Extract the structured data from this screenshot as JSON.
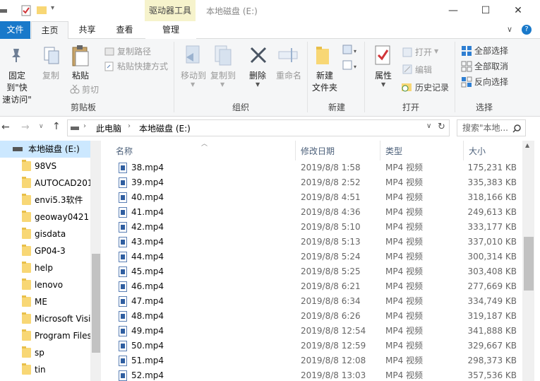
{
  "title_bar": {
    "context_tab": "驱动器工具",
    "window_title": "本地磁盘 (E:)",
    "minimize": "—",
    "maximize": "☐",
    "close": "✕"
  },
  "tabs": {
    "file": "文件",
    "home": "主页",
    "share": "共享",
    "view": "查看",
    "manage": "管理"
  },
  "ribbon": {
    "clipboard": {
      "label": "剪贴板",
      "pin_line1": "固定到\"快",
      "pin_line2": "速访问\"",
      "copy": "复制",
      "paste": "粘贴",
      "copy_path": "复制路径",
      "paste_shortcut": "粘贴快捷方式",
      "cut": "剪切"
    },
    "organize": {
      "label": "组织",
      "move_to": "移动到",
      "copy_to": "复制到",
      "delete": "删除",
      "rename": "重命名"
    },
    "new": {
      "label": "新建",
      "new_folder_line1": "新建",
      "new_folder_line2": "文件夹"
    },
    "open": {
      "label": "打开",
      "properties": "属性",
      "open": "打开",
      "edit": "编辑",
      "history": "历史记录"
    },
    "select": {
      "label": "选择",
      "select_all": "全部选择",
      "select_none": "全部取消",
      "invert": "反向选择"
    }
  },
  "address": {
    "crumb1": "此电脑",
    "crumb2": "本地磁盘 (E:)",
    "search_placeholder": "搜索\"本地..."
  },
  "nav": {
    "drive": "本地磁盘 (E:)",
    "folders": [
      "98VS",
      "AUTOCAD201",
      "envi5.3软件",
      "geoway0421",
      "gisdata",
      "GP04-3",
      "help",
      "lenovo",
      "ME",
      "Microsoft Visi",
      "Program Files",
      "sp",
      "tin"
    ]
  },
  "columns": {
    "name": "名称",
    "date": "修改日期",
    "type": "类型",
    "size": "大小"
  },
  "files": [
    {
      "name": "38.mp4",
      "date": "2019/8/8 1:58",
      "type": "MP4 视频",
      "size": "175,231 KB"
    },
    {
      "name": "39.mp4",
      "date": "2019/8/8 2:52",
      "type": "MP4 视频",
      "size": "335,383 KB"
    },
    {
      "name": "40.mp4",
      "date": "2019/8/8 4:51",
      "type": "MP4 视频",
      "size": "318,166 KB"
    },
    {
      "name": "41.mp4",
      "date": "2019/8/8 4:36",
      "type": "MP4 视频",
      "size": "249,613 KB"
    },
    {
      "name": "42.mp4",
      "date": "2019/8/8 5:10",
      "type": "MP4 视频",
      "size": "333,177 KB"
    },
    {
      "name": "43.mp4",
      "date": "2019/8/8 5:13",
      "type": "MP4 视频",
      "size": "337,010 KB"
    },
    {
      "name": "44.mp4",
      "date": "2019/8/8 5:24",
      "type": "MP4 视频",
      "size": "300,314 KB"
    },
    {
      "name": "45.mp4",
      "date": "2019/8/8 5:25",
      "type": "MP4 视频",
      "size": "303,408 KB"
    },
    {
      "name": "46.mp4",
      "date": "2019/8/8 6:21",
      "type": "MP4 视频",
      "size": "277,669 KB"
    },
    {
      "name": "47.mp4",
      "date": "2019/8/8 6:34",
      "type": "MP4 视频",
      "size": "334,749 KB"
    },
    {
      "name": "48.mp4",
      "date": "2019/8/8 6:26",
      "type": "MP4 视频",
      "size": "319,187 KB"
    },
    {
      "name": "49.mp4",
      "date": "2019/8/8 12:54",
      "type": "MP4 视频",
      "size": "341,888 KB"
    },
    {
      "name": "50.mp4",
      "date": "2019/8/8 12:59",
      "type": "MP4 视频",
      "size": "329,667 KB"
    },
    {
      "name": "51.mp4",
      "date": "2019/8/8 12:08",
      "type": "MP4 视频",
      "size": "298,373 KB"
    },
    {
      "name": "52.mp4",
      "date": "2019/8/8 13:03",
      "type": "MP4 视频",
      "size": "357,536 KB"
    }
  ],
  "colors": {
    "file_tab": "#1979ca",
    "context_tab": "#f6f3cc",
    "nav_selected": "#cce8ff",
    "folder": "#f8d775"
  }
}
